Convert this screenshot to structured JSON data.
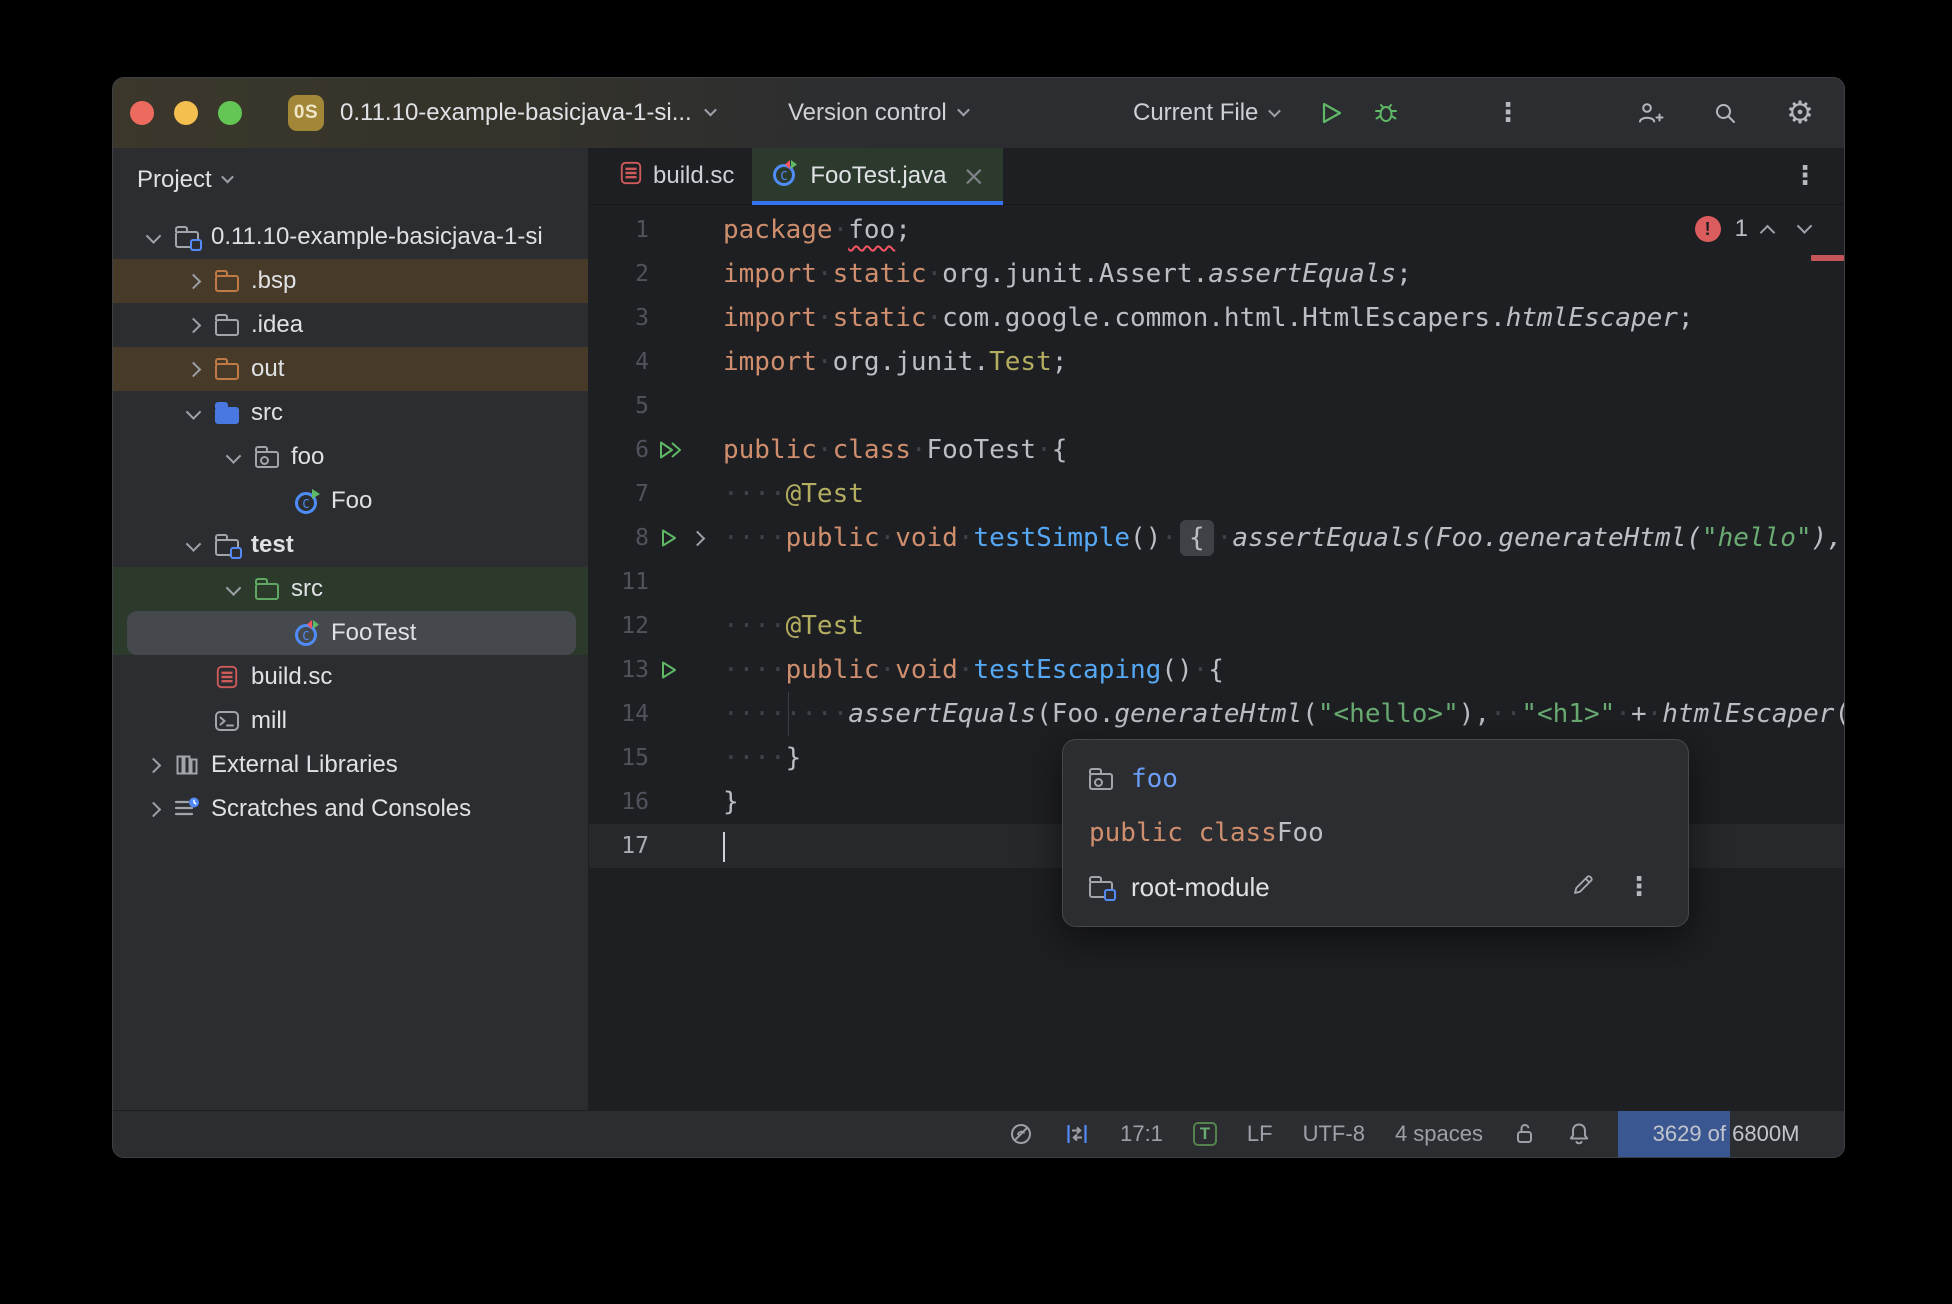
{
  "colors": {
    "accent_blue": "#3574F0",
    "run_green": "#5FB865",
    "error_red": "#DB5C5C",
    "keyword_orange": "#CF8E6D",
    "string_green": "#6AAB73",
    "method_blue": "#56A8F5",
    "annotation_yellow": "#B3AE60",
    "test_tab_green": "#2C3A2E"
  },
  "titlebar": {
    "badge": "0S",
    "title": "0.11.10-example-basicjava-1-si...",
    "version_control": "Version control",
    "run_config": "Current File"
  },
  "project_panel": {
    "header": "Project",
    "items": [
      {
        "label": "0.11.10-example-basicjava-1-si",
        "indent": 0,
        "icon": "module-folder",
        "chevron": "down"
      },
      {
        "label": ".bsp",
        "indent": 1,
        "icon": "excluded-folder",
        "chevron": "right",
        "bg": "brown"
      },
      {
        "label": ".idea",
        "indent": 1,
        "icon": "folder",
        "chevron": "right"
      },
      {
        "label": "out",
        "indent": 1,
        "icon": "excluded-folder",
        "chevron": "right",
        "bg": "brown"
      },
      {
        "label": "src",
        "indent": 1,
        "icon": "source-folder",
        "chevron": "down"
      },
      {
        "label": "foo",
        "indent": 2,
        "icon": "package-folder",
        "chevron": "down"
      },
      {
        "label": "Foo",
        "indent": 3,
        "icon": "class-run"
      },
      {
        "label": "test",
        "indent": 1,
        "icon": "module-folder",
        "chevron": "down",
        "bold": true
      },
      {
        "label": "src",
        "indent": 2,
        "icon": "test-folder",
        "chevron": "down",
        "bg": "green"
      },
      {
        "label": "FooTest",
        "indent": 3,
        "icon": "class-test",
        "bg": "green",
        "selected": true
      },
      {
        "label": "build.sc",
        "indent": 1,
        "icon": "scala-file"
      },
      {
        "label": "mill",
        "indent": 1,
        "icon": "terminal-file"
      },
      {
        "label": "External Libraries",
        "indent": 0,
        "icon": "libraries",
        "chevron": "right"
      },
      {
        "label": "Scratches and Consoles",
        "indent": 0,
        "icon": "scratches",
        "chevron": "right"
      }
    ]
  },
  "tabs": [
    {
      "label": "build.sc",
      "icon": "scala-file"
    },
    {
      "label": "FooTest.java",
      "icon": "class-test",
      "active": true
    }
  ],
  "editor": {
    "error_count": "1",
    "lines": [
      {
        "n": "1",
        "seg": [
          [
            "kw",
            "package"
          ],
          [
            "ws",
            "·"
          ],
          [
            "err",
            "foo"
          ],
          [
            "pl",
            ";"
          ]
        ]
      },
      {
        "n": "2",
        "seg": [
          [
            "kw",
            "import"
          ],
          [
            "ws",
            "·"
          ],
          [
            "kw",
            "static"
          ],
          [
            "ws",
            "·"
          ],
          [
            "pl",
            "org.junit.Assert."
          ],
          [
            "it",
            "assertEquals"
          ],
          [
            "pl",
            ";"
          ]
        ]
      },
      {
        "n": "3",
        "seg": [
          [
            "kw",
            "import"
          ],
          [
            "ws",
            "·"
          ],
          [
            "kw",
            "static"
          ],
          [
            "ws",
            "·"
          ],
          [
            "pl",
            "com.google.common.html.HtmlEscapers."
          ],
          [
            "it",
            "htmlEscaper"
          ],
          [
            "pl",
            ";"
          ]
        ]
      },
      {
        "n": "4",
        "seg": [
          [
            "kw",
            "import"
          ],
          [
            "ws",
            "·"
          ],
          [
            "pl",
            "org.junit."
          ],
          [
            "cls",
            "Test"
          ],
          [
            "pl",
            ";"
          ]
        ]
      },
      {
        "n": "5",
        "seg": []
      },
      {
        "n": "6",
        "g": "run-all",
        "seg": [
          [
            "kw",
            "public"
          ],
          [
            "ws",
            "·"
          ],
          [
            "kw",
            "class"
          ],
          [
            "ws",
            "·"
          ],
          [
            "pl",
            "FooTest"
          ],
          [
            "ws",
            "·"
          ],
          [
            "pl",
            "{"
          ]
        ]
      },
      {
        "n": "7",
        "seg": [
          [
            "ws",
            "····"
          ],
          [
            "ann",
            "@Test"
          ]
        ]
      },
      {
        "n": "8",
        "g": "run-fold",
        "seg": [
          [
            "ws",
            "····"
          ],
          [
            "kw",
            "public"
          ],
          [
            "ws",
            "·"
          ],
          [
            "kw",
            "void"
          ],
          [
            "ws",
            "·"
          ],
          [
            "fn",
            "testSimple"
          ],
          [
            "pl",
            "()"
          ],
          [
            "ws",
            "·"
          ],
          [
            "fold",
            "{"
          ],
          [
            "ws",
            "·"
          ],
          [
            "it",
            "assertEquals(Foo.generateHtml("
          ],
          [
            "stri",
            "\"hello\""
          ],
          [
            "it",
            "),"
          ],
          [
            "ws",
            "··"
          ]
        ]
      },
      {
        "n": "11",
        "seg": []
      },
      {
        "n": "12",
        "seg": [
          [
            "ws",
            "····"
          ],
          [
            "ann",
            "@Test"
          ]
        ]
      },
      {
        "n": "13",
        "g": "run",
        "seg": [
          [
            "ws",
            "····"
          ],
          [
            "kw",
            "public"
          ],
          [
            "ws",
            "·"
          ],
          [
            "kw",
            "void"
          ],
          [
            "ws",
            "·"
          ],
          [
            "fn",
            "testEscaping"
          ],
          [
            "pl",
            "()"
          ],
          [
            "ws",
            "·"
          ],
          [
            "pl",
            "{"
          ]
        ]
      },
      {
        "n": "14",
        "guide": true,
        "seg": [
          [
            "ws",
            "········"
          ],
          [
            "it",
            "assertEquals"
          ],
          [
            "pl",
            "(Foo."
          ],
          [
            "it",
            "generateHtml"
          ],
          [
            "pl",
            "("
          ],
          [
            "str",
            "\"<hello>\""
          ],
          [
            "pl",
            "),"
          ],
          [
            "ws",
            "··"
          ],
          [
            "str",
            "\"<h1>\""
          ],
          [
            "ws",
            "·"
          ],
          [
            "pl",
            "+"
          ],
          [
            "ws",
            "·"
          ],
          [
            "it",
            "htmlEscaper"
          ],
          [
            "pl",
            "("
          ]
        ]
      },
      {
        "n": "15",
        "seg": [
          [
            "ws",
            "····"
          ],
          [
            "pl",
            "}"
          ]
        ]
      },
      {
        "n": "16",
        "seg": [
          [
            "pl",
            "}"
          ]
        ]
      },
      {
        "n": "17",
        "active": true,
        "caret": true,
        "seg": []
      }
    ]
  },
  "popup": {
    "package_name": "foo",
    "declaration_keyword": "public class ",
    "class_name": "Foo",
    "module_name": "root-module"
  },
  "status_bar": {
    "caret_position": "17:1",
    "file_type_badge": "T",
    "line_separator": "LF",
    "encoding": "UTF-8",
    "indent": "4 spaces",
    "memory": "3629 of 6800M"
  }
}
